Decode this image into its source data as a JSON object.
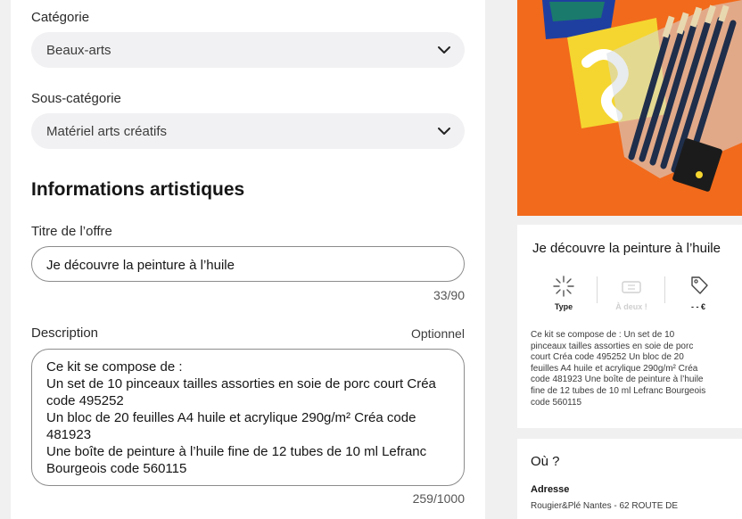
{
  "form": {
    "category": {
      "label": "Catégorie",
      "value": "Beaux-arts"
    },
    "subcategory": {
      "label": "Sous-catégorie",
      "value": "Matériel arts créatifs"
    },
    "section_title": "Informations artistiques",
    "title_field": {
      "label": "Titre de l’offre",
      "value": "Je découvre la peinture à l’huile",
      "counter": "33/90"
    },
    "description": {
      "label": "Description",
      "optional": "Optionnel",
      "lines": [
        "Ce kit se compose de :",
        "Un set de 10 pinceaux tailles assorties en soie de porc court Créa",
        "code 495252",
        "Un bloc de 20 feuilles A4 huile et acrylique 290g/m² Créa code",
        "481923",
        "Une boîte de peinture à l’huile fine de 12 tubes de 10 ml Lefranc",
        "Bourgeois code 560115"
      ],
      "counter": "259/1000"
    }
  },
  "preview": {
    "title": "Je découvre la peinture à l’huile",
    "meta": [
      {
        "icon": "sparkle-icon",
        "label": "Type"
      },
      {
        "icon": "ticket-icon",
        "label": "À deux !"
      },
      {
        "icon": "price-tag-icon",
        "label": "- - €"
      }
    ],
    "description_lines": [
      "Ce kit se compose de : Un set de 10",
      "pinceaux tailles assorties en soie de porc",
      "court Créa code 495252 Un bloc de 20",
      "feuilles A4 huile et acrylique 290g/m² Créa",
      "code 481923 Une boîte de peinture à l’huile",
      "fine de 12 tubes de 10 ml Lefranc Bourgeois",
      "code 560115"
    ],
    "where": {
      "title": "Où ?",
      "address_label": "Adresse",
      "address_value": "Rougier&Plé Nantes - 62 ROUTE DE"
    }
  },
  "colors": {
    "accent_orange": "#f26a1b",
    "input_bg": "#f1f1f3",
    "border": "#8c8c8c"
  }
}
